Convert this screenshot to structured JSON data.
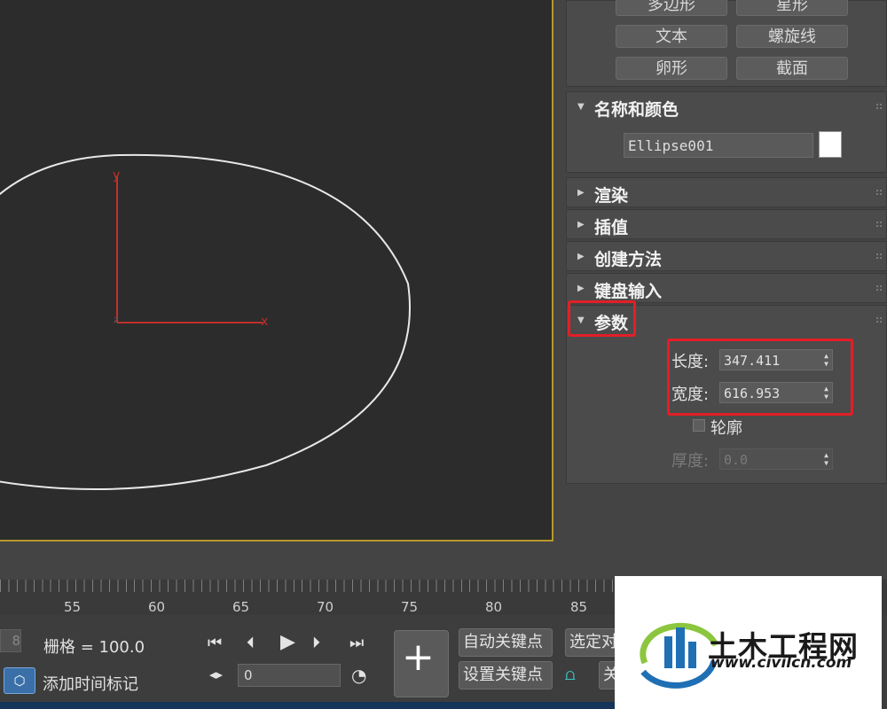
{
  "create_buttons": [
    "多边形",
    "星形",
    "文本",
    "螺旋线",
    "卵形",
    "截面"
  ],
  "name_color": {
    "title": "名称和颜色",
    "object_name": "Ellipse001",
    "swatch_color": "#ffffff"
  },
  "rollouts": [
    "渲染",
    "插值",
    "创建方法",
    "键盘输入"
  ],
  "parameters": {
    "title": "参数",
    "length_label": "长度:",
    "length_value": "347.411",
    "width_label": "宽度:",
    "width_value": "616.953",
    "outline_label": "轮廓",
    "thickness_label": "厚度:",
    "thickness_value": "0.0"
  },
  "viewport": {
    "axis_y": "y",
    "axis_x": "x",
    "axis_z": "z",
    "frame_color": "#b8982a"
  },
  "timeline": {
    "ticks": [
      "55",
      "60",
      "65",
      "70",
      "75",
      "80",
      "85"
    ]
  },
  "status_bar": {
    "frame_stub": "8",
    "grid_label": "栅格 = 100.0",
    "add_time_tag": "添加时间标记",
    "frame_value": "0",
    "auto_key": "自动关键点",
    "set_key": "设置关键点",
    "selected": "选定对",
    "key_filter_stub": "关"
  },
  "watermark": {
    "title": "土木工程网",
    "url": "www.civilcn.com"
  },
  "colors": {
    "highlight": "#e41e26",
    "panel": "#4b4b4b",
    "viewport": "#2c2c2c"
  }
}
